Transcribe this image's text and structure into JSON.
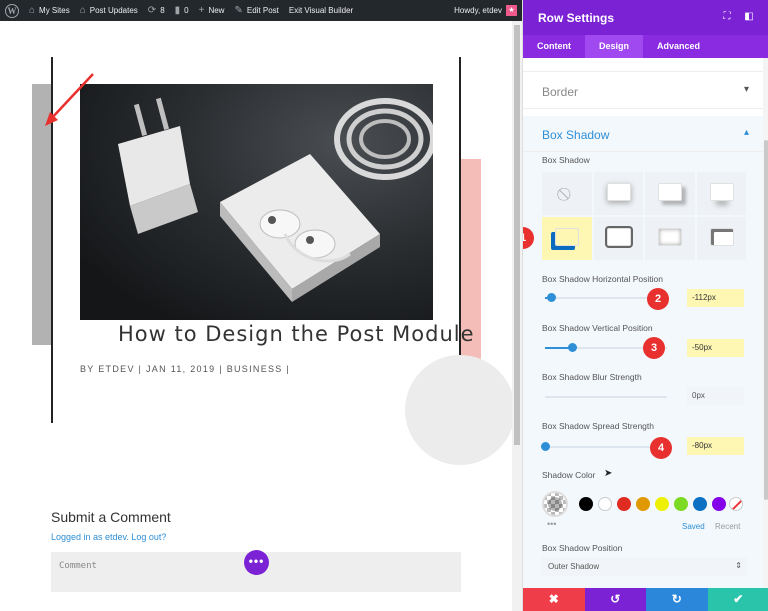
{
  "admin_bar": {
    "my_sites": "My Sites",
    "post_updates": "Post Updates",
    "updates_count": "8",
    "comments_count": "0",
    "new_label": "New",
    "edit_post": "Edit Post",
    "exit_builder": "Exit Visual Builder",
    "howdy": "Howdy, etdev"
  },
  "post": {
    "title": "How to Design the Post Module",
    "meta": "BY ETDEV | JAN 11, 2019 | BUSINESS |"
  },
  "comments": {
    "title": "Submit a Comment",
    "logged_in": "Logged in as etdev. Log out?",
    "placeholder": "Comment"
  },
  "panel": {
    "title": "Row Settings",
    "tabs": [
      {
        "label": "Content",
        "active": false
      },
      {
        "label": "Design",
        "active": true
      },
      {
        "label": "Advanced",
        "active": false
      }
    ],
    "sections": {
      "border": "Border",
      "box_shadow": "Box Shadow"
    },
    "box_shadow_label": "Box Shadow",
    "presets_selected_index": 4,
    "fields": {
      "horizontal": {
        "label": "Box Shadow Horizontal Position",
        "value": "-112px",
        "slider": 0.05,
        "badge": "2"
      },
      "vertical": {
        "label": "Box Shadow Vertical Position",
        "value": "-50px",
        "slider": 0.22,
        "badge": "3"
      },
      "blur": {
        "label": "Box Shadow Blur Strength",
        "value": "0px",
        "slider": 0.0
      },
      "spread": {
        "label": "Box Shadow Spread Strength",
        "value": "-80px",
        "slider": 0.0,
        "badge": "4"
      }
    },
    "preset_badge": "1",
    "shadow_color": {
      "label": "Shadow Color",
      "swatches": [
        "#000000",
        "#ffffff",
        "#e02b20",
        "#e09900",
        "#edf000",
        "#7cda24",
        "#0c71c3",
        "#8300e9"
      ],
      "saved": "Saved",
      "recent": "Recent"
    },
    "position": {
      "label": "Box Shadow Position",
      "value": "Outer Shadow"
    },
    "footer_colors": [
      "#ef3e4a",
      "#7b22d4",
      "#2b87da",
      "#29c4a9"
    ]
  },
  "colors": {
    "accent": "#7b22d4",
    "link": "#2e8fd7",
    "badge": "#e8302f",
    "highlight": "#fdf7b3"
  }
}
